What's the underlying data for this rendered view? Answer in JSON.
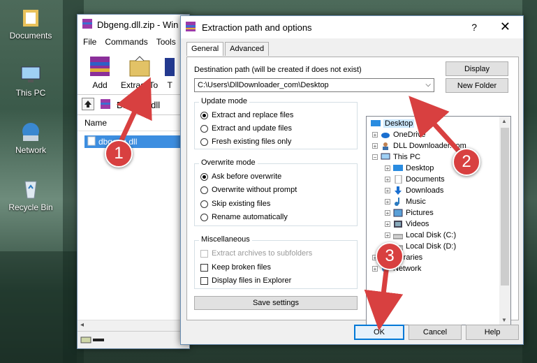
{
  "desktop": {
    "icons": [
      {
        "label": "Documents"
      },
      {
        "label": "This PC"
      },
      {
        "label": "Network"
      },
      {
        "label": "Recycle Bin"
      }
    ]
  },
  "winrar": {
    "title": "Dbgeng.dll.zip - Win",
    "menu": [
      "File",
      "Commands",
      "Tools"
    ],
    "tools": [
      {
        "label": "Add"
      },
      {
        "label": "Extract To"
      },
      {
        "label": "T"
      }
    ],
    "path": "Dbgeng.dll",
    "column_header": "Name",
    "selected_file": "dbgeng.dll"
  },
  "dialog": {
    "title": "Extraction path and options",
    "help_glyph": "?",
    "close_glyph": "✕",
    "tabs": [
      "General",
      "Advanced"
    ],
    "dest_label": "Destination path (will be created if does not exist)",
    "dest_value": "C:\\Users\\DllDownloader_com\\Desktop",
    "display_button": "Display",
    "new_folder_button": "New Folder",
    "update_mode": {
      "title": "Update mode",
      "options": [
        "Extract and replace files",
        "Extract and update files",
        "Fresh existing files only"
      ],
      "selected": 0
    },
    "overwrite_mode": {
      "title": "Overwrite mode",
      "options": [
        "Ask before overwrite",
        "Overwrite without prompt",
        "Skip existing files",
        "Rename automatically"
      ],
      "selected": 0
    },
    "misc": {
      "title": "Miscellaneous",
      "options": [
        "Extract archives to subfolders",
        "Keep broken files",
        "Display files in Explorer"
      ],
      "disabled": [
        true,
        false,
        false
      ]
    },
    "save_settings": "Save settings",
    "tree": [
      {
        "label": "Desktop",
        "selected": true
      },
      {
        "label": "OneDrive"
      },
      {
        "label": "DLL Downloader.com"
      },
      {
        "label": "This PC"
      },
      {
        "label": "Desktop"
      },
      {
        "label": "Documents"
      },
      {
        "label": "Downloads"
      },
      {
        "label": "Music"
      },
      {
        "label": "Pictures"
      },
      {
        "label": "Videos"
      },
      {
        "label": "Local Disk (C:)"
      },
      {
        "label": "Local Disk (D:)"
      },
      {
        "label": "Libraries"
      },
      {
        "label": "Network"
      }
    ],
    "ok_button": "OK",
    "cancel_button": "Cancel",
    "help_button": "Help"
  },
  "callouts": [
    "1",
    "2",
    "3"
  ],
  "colors": {
    "callout": "#d84040",
    "selection": "#3d8ee0",
    "accent": "#0078d7"
  }
}
